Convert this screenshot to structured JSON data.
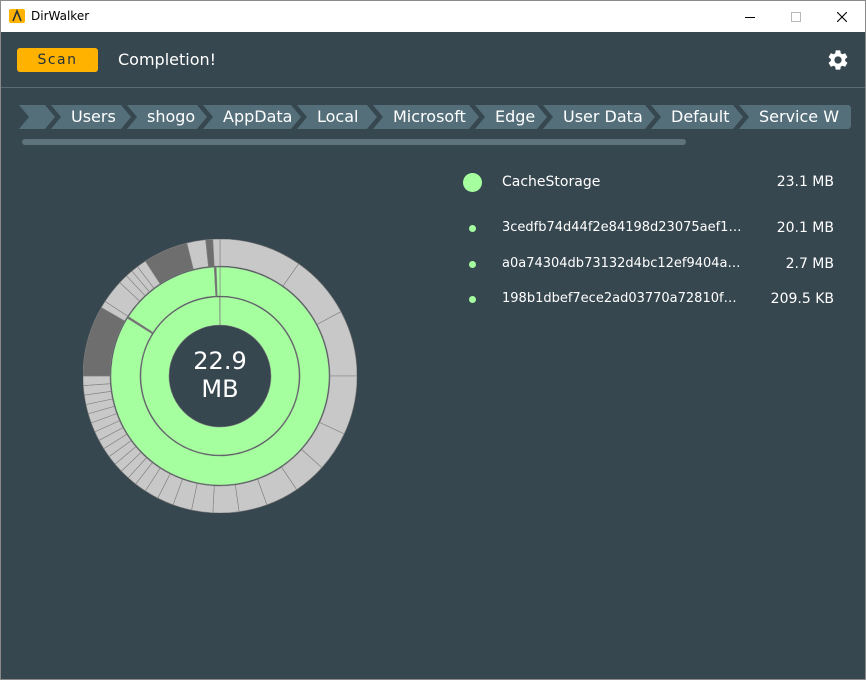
{
  "window": {
    "title": "DirWalker"
  },
  "header": {
    "scan_label": "Scan",
    "status": "Completion!"
  },
  "breadcrumb": {
    "items": [
      "Users",
      "shogo",
      "AppData",
      "Local",
      "Microsoft",
      "Edge",
      "User Data",
      "Default",
      "Service W"
    ]
  },
  "chart": {
    "center_value": "22.9",
    "center_unit": "MB"
  },
  "list": {
    "selected": {
      "name": "CacheStorage",
      "size": "23.1 MB"
    },
    "items": [
      {
        "name": "3cedfb74d44f2e84198d23075aef1…",
        "size": "20.1 MB"
      },
      {
        "name": "a0a74304db73132d4bc12ef9404a…",
        "size": "2.7 MB"
      },
      {
        "name": "198b1dbef7ece2ad03770a72810f…",
        "size": "209.5 KB"
      }
    ]
  },
  "colors": {
    "background": "#37474f",
    "accent": "#ffb300",
    "selected": "#a5ff9f",
    "other_segment": "#c8c8c8",
    "dark_segment": "#6e6e6e"
  }
}
